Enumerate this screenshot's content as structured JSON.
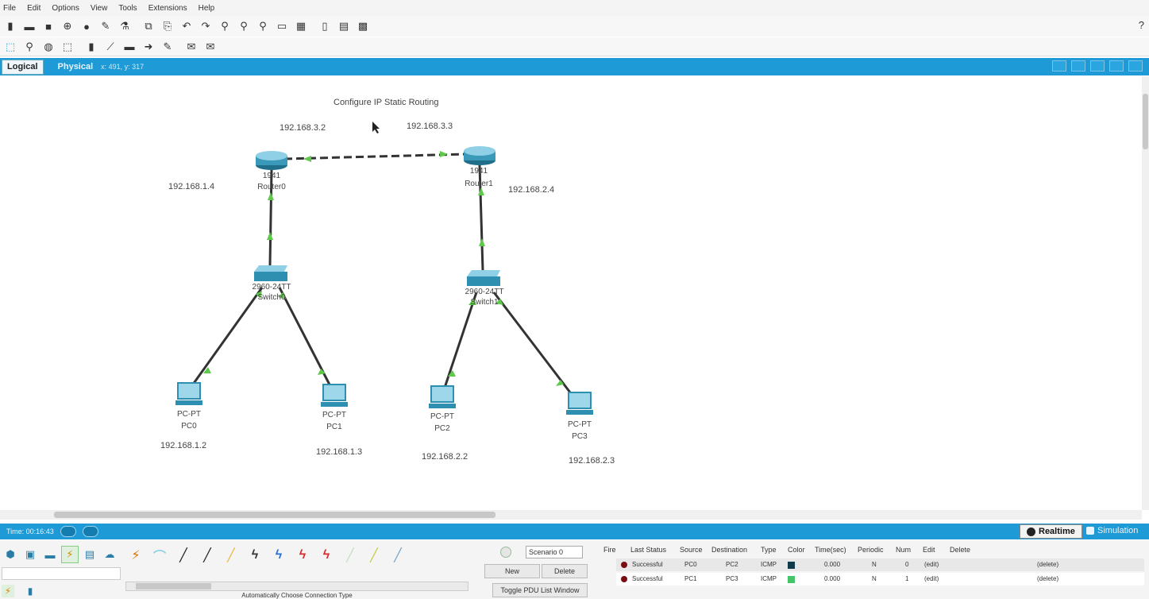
{
  "menu": [
    "File",
    "Edit",
    "Options",
    "View",
    "Tools",
    "Extensions",
    "Help"
  ],
  "toolbar": {
    "row1_icons": [
      "new-icon",
      "open-icon",
      "save-icon",
      "print-icon",
      "activity-wizard-icon",
      "network-info-icon",
      "copy-icon",
      "paste-icon",
      "undo-icon",
      "redo-icon",
      "zoom-in-icon",
      "zoom-reset-icon",
      "zoom-out-icon",
      "drawing-palette-icon",
      "custom-device-icon",
      "viewport-icon",
      "cluster-icon"
    ],
    "row2_icons": [
      "select-icon",
      "inspect-icon",
      "move-layout-icon",
      "place-note-icon",
      "delete-icon",
      "resize-shape-icon",
      "freeform-icon",
      "line-icon",
      "add-pdu-icon",
      "add-complex-pdu-icon"
    ],
    "help": "?"
  },
  "workspace": {
    "logical_tab": "Logical",
    "physical_tab": "Physical",
    "coords": "x: 491, y: 317"
  },
  "topology": {
    "title": "Configure IP Static Routing",
    "ip_labels": [
      "192.168.3.2",
      "192.168.3.3",
      "192.168.1.4",
      "192.168.2.4",
      "192.168.1.2",
      "192.168.1.3",
      "192.168.2.2",
      "192.168.2.3"
    ],
    "devices": [
      {
        "type": "router",
        "model": "1941",
        "name": "Router0"
      },
      {
        "type": "router",
        "model": "1941",
        "name": "Router1"
      },
      {
        "type": "switch",
        "model": "2960-24TT",
        "name": "Switch0"
      },
      {
        "type": "switch",
        "model": "2960-24TT",
        "name": "Switch1"
      },
      {
        "type": "pc",
        "model": "PC-PT",
        "name": "PC0"
      },
      {
        "type": "pc",
        "model": "PC-PT",
        "name": "PC1"
      },
      {
        "type": "pc",
        "model": "PC-PT",
        "name": "PC2"
      },
      {
        "type": "pc",
        "model": "PC-PT",
        "name": "PC3"
      }
    ],
    "link_color": "#333333",
    "port_color": "#5ec94a",
    "cursor_icon": "mouse-pointer-icon"
  },
  "timebar": {
    "time": "Time: 00:16:43",
    "realtime_label": "Realtime",
    "simulation_label": "Simulation"
  },
  "bottom": {
    "device_categories": [
      "network-devices-icon",
      "end-devices-icon",
      "components-icon",
      "connections-icon",
      "misc-icon",
      "multiuser-icon"
    ],
    "cable_caption": "Automatically Choose Connection Type",
    "scenario_select": "Scenario 0",
    "new_button": "New",
    "delete_button": "Delete",
    "toggle_button": "Toggle PDU List Window",
    "pdu_headers": [
      "Fire",
      "Last Status",
      "Source",
      "Destination",
      "Type",
      "Color",
      "Time(sec)",
      "Periodic",
      "Num",
      "Edit",
      "Delete"
    ],
    "pdu_rows": [
      {
        "status": "Successful",
        "source": "PC0",
        "destination": "PC2",
        "type": "ICMP",
        "color": "#0f3b4a",
        "time": "0.000",
        "periodic": "N",
        "num": "0",
        "edit": "(edit)",
        "delete": "(delete)"
      },
      {
        "status": "Successful",
        "source": "PC1",
        "destination": "PC3",
        "type": "ICMP",
        "color": "#46c46a",
        "time": "0.000",
        "periodic": "N",
        "num": "1",
        "edit": "(edit)",
        "delete": "(delete)"
      }
    ]
  },
  "colors": {
    "accent_bar": "#1e9bd7",
    "device_teal": "#2f8fb0"
  }
}
